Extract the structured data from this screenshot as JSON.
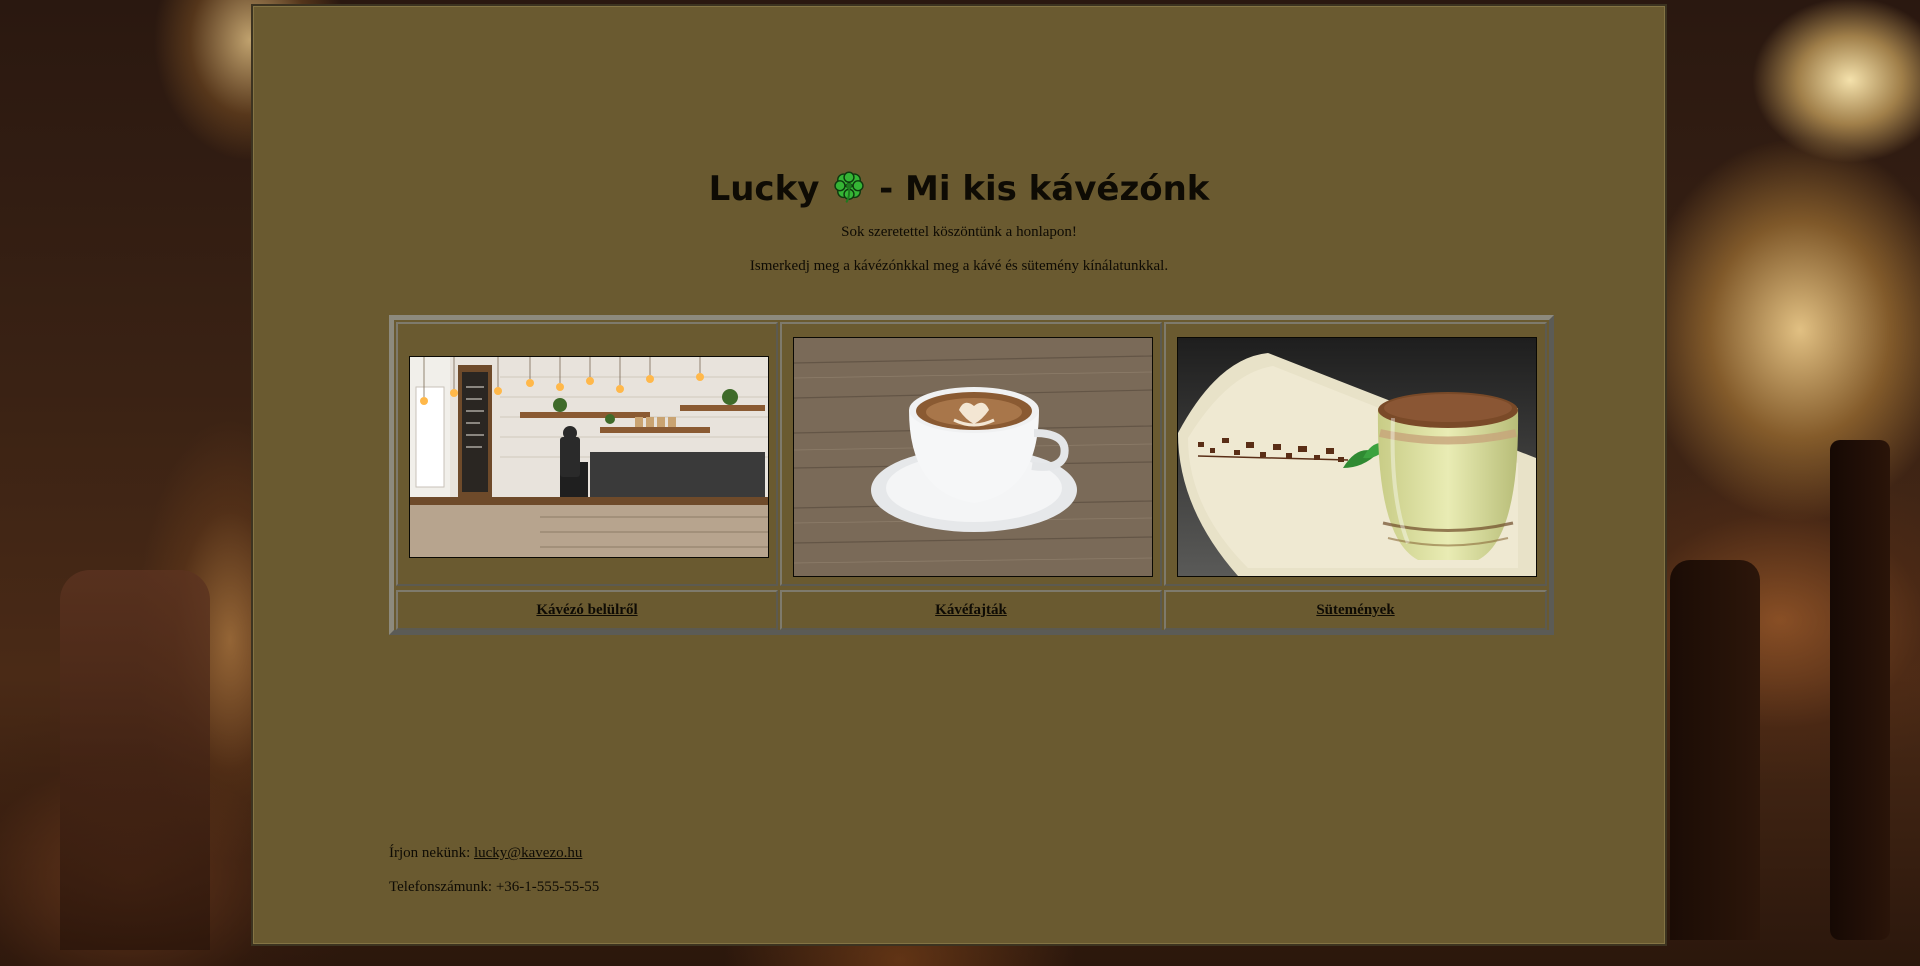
{
  "header": {
    "title_before": "Lucky",
    "title_after": "- Mi kis kávézónk",
    "greeting": "Sok szeretettel köszöntünk a honlapon!",
    "invitation": "Ismerkedj meg a kávézónkkal meg a kávé és sütemény kínálatunkkal."
  },
  "gallery": {
    "items": [
      {
        "link": "Kávézó belülről",
        "image": "cafe-interior-photo"
      },
      {
        "link": "Kávéfajták",
        "image": "latte-cup-photo"
      },
      {
        "link": "Sütemények",
        "image": "tiramisu-dessert-photo"
      }
    ]
  },
  "footer": {
    "email_label": "Írjon nekünk:",
    "email": "lucky@kavezo.hu",
    "phone_label": "Telefonszámunk:",
    "phone": "+36-1-555-55-55"
  },
  "colors": {
    "page_background": "#6a5a30",
    "text": "#0e0b04",
    "clover": "#2fa52f"
  }
}
